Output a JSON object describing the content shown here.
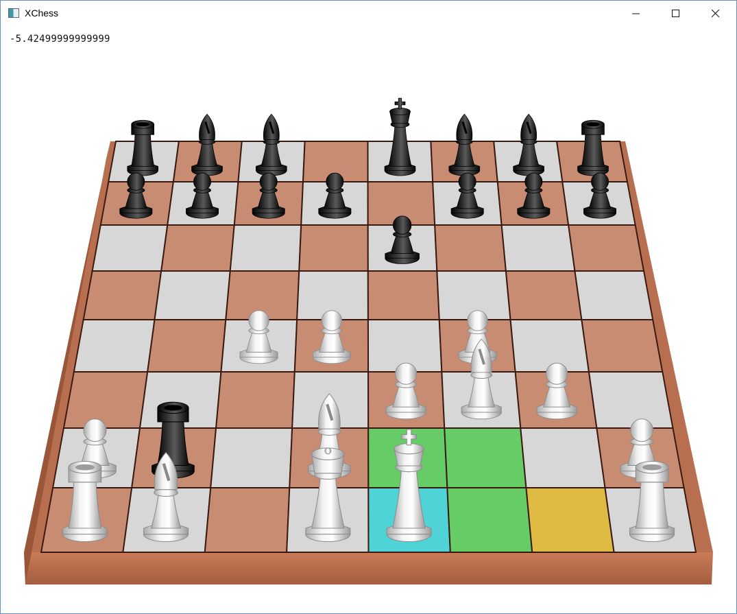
{
  "window": {
    "title": "XChess",
    "icon": "app-icon",
    "controls": [
      "minimize-icon",
      "maximize-icon",
      "close-icon"
    ]
  },
  "evaluation": "-5.42499999999999",
  "colors": {
    "light_square": "#d7d7d7",
    "dark_square": "#c78c72",
    "board_frame": "#b86f4f",
    "highlight_green": "#66cc66",
    "highlight_cyan": "#4fd3d6",
    "highlight_yellow": "#e0bb44",
    "white_piece": "#e8e8e8",
    "black_piece": "#1c1c1c"
  },
  "board": {
    "files": [
      "a",
      "b",
      "c",
      "d",
      "e",
      "f",
      "g",
      "h"
    ],
    "ranks": [
      1,
      2,
      3,
      4,
      5,
      6,
      7,
      8
    ],
    "highlights": [
      {
        "square": "e1",
        "type": "selected",
        "color": "highlight_cyan"
      },
      {
        "square": "e2",
        "type": "move",
        "color": "highlight_green"
      },
      {
        "square": "f2",
        "type": "move",
        "color": "highlight_green"
      },
      {
        "square": "f1",
        "type": "move",
        "color": "highlight_green"
      },
      {
        "square": "g1",
        "type": "castle",
        "color": "highlight_yellow"
      }
    ],
    "pieces": [
      {
        "square": "a8",
        "color": "black",
        "type": "rook"
      },
      {
        "square": "b8",
        "color": "black",
        "type": "bishop"
      },
      {
        "square": "c8",
        "color": "black",
        "type": "bishop"
      },
      {
        "square": "e8",
        "color": "black",
        "type": "king"
      },
      {
        "square": "f8",
        "color": "black",
        "type": "bishop"
      },
      {
        "square": "g8",
        "color": "black",
        "type": "bishop"
      },
      {
        "square": "h8",
        "color": "black",
        "type": "rook"
      },
      {
        "square": "a7",
        "color": "black",
        "type": "pawn"
      },
      {
        "square": "b7",
        "color": "black",
        "type": "pawn"
      },
      {
        "square": "c7",
        "color": "black",
        "type": "pawn"
      },
      {
        "square": "d7",
        "color": "black",
        "type": "pawn"
      },
      {
        "square": "f7",
        "color": "black",
        "type": "pawn"
      },
      {
        "square": "g7",
        "color": "black",
        "type": "pawn"
      },
      {
        "square": "h7",
        "color": "black",
        "type": "pawn"
      },
      {
        "square": "e6",
        "color": "black",
        "type": "pawn"
      },
      {
        "square": "b2",
        "color": "black",
        "type": "rook"
      },
      {
        "square": "c4",
        "color": "white",
        "type": "pawn"
      },
      {
        "square": "d4",
        "color": "white",
        "type": "pawn"
      },
      {
        "square": "f4",
        "color": "white",
        "type": "pawn"
      },
      {
        "square": "e3",
        "color": "white",
        "type": "pawn"
      },
      {
        "square": "f3",
        "color": "white",
        "type": "bishop"
      },
      {
        "square": "g3",
        "color": "white",
        "type": "pawn"
      },
      {
        "square": "a2",
        "color": "white",
        "type": "pawn"
      },
      {
        "square": "d2",
        "color": "white",
        "type": "bishop"
      },
      {
        "square": "h2",
        "color": "white",
        "type": "pawn"
      },
      {
        "square": "a1",
        "color": "white",
        "type": "rook"
      },
      {
        "square": "b1",
        "color": "white",
        "type": "bishop"
      },
      {
        "square": "d1",
        "color": "white",
        "type": "queen"
      },
      {
        "square": "e1",
        "color": "white",
        "type": "king"
      },
      {
        "square": "h1",
        "color": "white",
        "type": "rook"
      }
    ]
  }
}
